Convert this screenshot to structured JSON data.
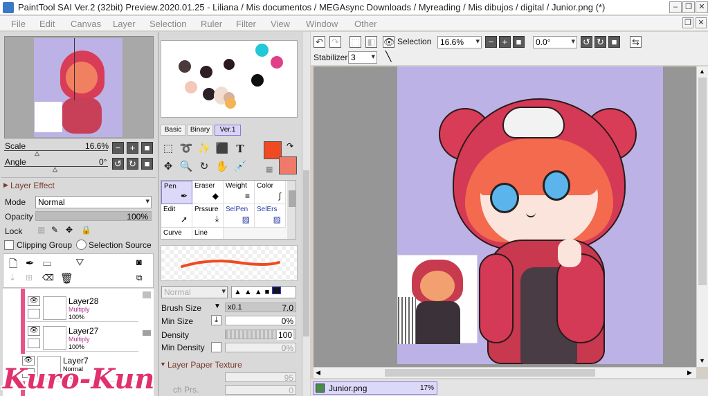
{
  "window": {
    "title": "PaintTool SAI Ver.2 (32bit) Preview.2020.01.25 - Liliana / Mis documentos / MEGAsync Downloads / Myreading / Mis dibujos / digital / Junior.png (*)"
  },
  "menu": [
    "File",
    "Edit",
    "Canvas",
    "Layer",
    "Selection",
    "Ruler",
    "Filter",
    "View",
    "Window",
    "Other"
  ],
  "navigator": {
    "scale_label": "Scale",
    "scale_value": "16.6%",
    "angle_label": "Angle",
    "angle_value": "0°"
  },
  "layer_effect": {
    "header": "Layer Effect",
    "mode_label": "Mode",
    "mode_value": "Normal",
    "opacity_label": "Opacity",
    "opacity_value": "100%",
    "opacity_level": 1.0,
    "lock_label": "Lock",
    "clipping_label": "Clipping Group",
    "selection_source_label": "Selection Source"
  },
  "layers": [
    {
      "name": "Layer28",
      "mode": "Multiply",
      "opacity": "100%"
    },
    {
      "name": "Layer27",
      "mode": "Multiply",
      "opacity": "100%"
    },
    {
      "name": "Layer7",
      "mode": "Normal",
      "opacity": "100%"
    }
  ],
  "color_tabs": [
    "Basic",
    "Binary",
    "Ver.1"
  ],
  "colors": {
    "primary": "#f04a23",
    "secondary": "#f07a6a"
  },
  "swatches": [
    "#4a3a3c",
    "#2e1f26",
    "#2a1a20",
    "#22c8d8",
    "#e0408a",
    "#f4c8b8",
    "#2a2028",
    "#f0ddd0",
    "#d8b0a0",
    "#f2b455",
    "#0f0f12"
  ],
  "brushes": [
    {
      "name": "Pen",
      "color": "#000"
    },
    {
      "name": "Eraser",
      "color": "#000"
    },
    {
      "name": "Weight",
      "color": "#000"
    },
    {
      "name": "Color",
      "color": "#000"
    },
    {
      "name": "Edit",
      "color": "#000"
    },
    {
      "name": "Prssure",
      "color": "#000"
    },
    {
      "name": "SelPen",
      "color": "#2a3aa8"
    },
    {
      "name": "SelErs",
      "color": "#2a3aa8"
    },
    {
      "name": "Curve",
      "color": "#000"
    },
    {
      "name": "Line",
      "color": "#000"
    }
  ],
  "brush_settings": {
    "blend_mode": "Normal",
    "size_label": "Brush Size",
    "size_mult": "x0.1",
    "size_value": "7.0",
    "min_size_label": "Min Size",
    "min_size_value": "0%",
    "density_label": "Density",
    "density_value": "100",
    "min_density_label": "Min Density",
    "min_density_value": "0%",
    "paper_texture_header": "Layer Paper Texture",
    "paper_value1": "95",
    "paper_label2": "ch Prs.",
    "paper_value2": "0"
  },
  "toolbar": {
    "selection_label": "Selection",
    "zoom_value": "16.6%",
    "angle_value": "0.0°",
    "stabilizer_label": "Stabilizer",
    "stabilizer_value": "3"
  },
  "document_tab": {
    "name": "Junior.png",
    "zoom": "17%"
  },
  "watermark": "Kuro-Kun"
}
